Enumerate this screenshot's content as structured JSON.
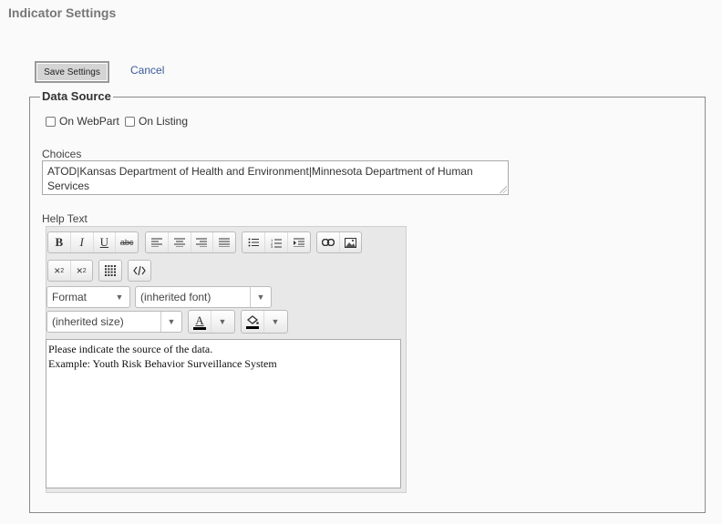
{
  "page": {
    "title": "Indicator Settings"
  },
  "actions": {
    "save_label": "Save Settings",
    "cancel_label": "Cancel"
  },
  "data_source": {
    "legend": "Data Source",
    "checkboxes": [
      {
        "label": "On WebPart",
        "checked": false
      },
      {
        "label": "On Listing",
        "checked": false
      }
    ],
    "choices_label": "Choices",
    "choices_value": "ATOD|Kansas Department of Health and Environment|Minnesota Department of Human Services",
    "help_label": "Help Text"
  },
  "editor": {
    "toolbar": {
      "bold": "B",
      "italic": "I",
      "underline": "U",
      "strike": "abc",
      "format_label": "Format",
      "font_label": "(inherited font)",
      "size_label": "(inherited size)",
      "text_color_glyph": "A"
    },
    "content_lines": [
      "Please indicate the source of the data.",
      "Example: Youth Risk Behavior Surveillance System"
    ]
  },
  "colors": {
    "text_color": "#000000",
    "highlight_color": "#000000",
    "link": "#3b5998"
  }
}
